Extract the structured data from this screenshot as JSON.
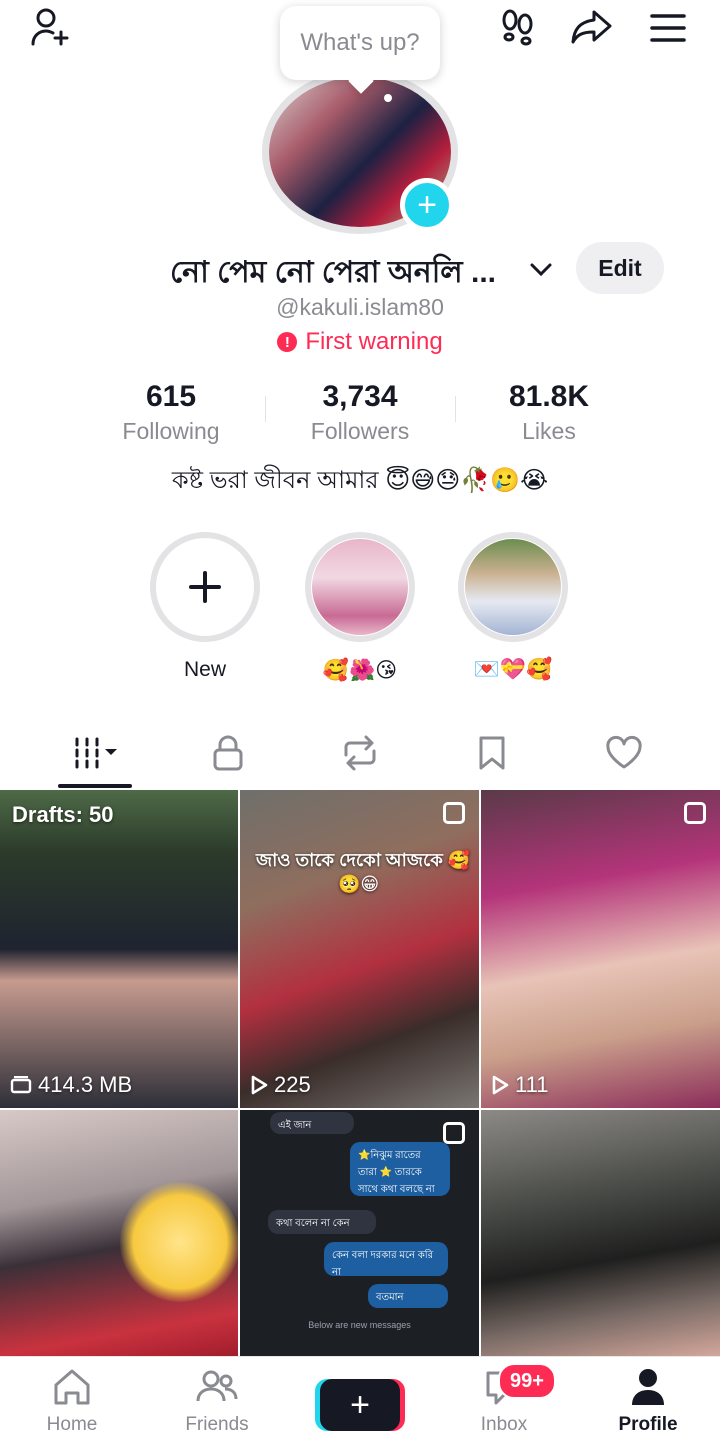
{
  "bubble": {
    "text": "What's up?"
  },
  "profile": {
    "name": "নো পেম নো পেরা অনলি ...",
    "handle": "@kakuli.islam80",
    "warning": "First warning",
    "edit_label": "Edit",
    "bio": "কষ্ট ভরা জীবন আমার 😇😅😓🥀🥲😭"
  },
  "stats": [
    {
      "value": "615",
      "label": "Following"
    },
    {
      "value": "3,734",
      "label": "Followers"
    },
    {
      "value": "81.8K",
      "label": "Likes"
    }
  ],
  "highlights": [
    {
      "label": "New"
    },
    {
      "label": "🥰🌺😘"
    },
    {
      "label": "💌💝🥰"
    }
  ],
  "grid": {
    "drafts": "Drafts: 50",
    "drafts_size": "414.3 MB",
    "video2_caption": "জাও তাকে দেকো আজকে 🥰",
    "video2_caption2": "🥺😁",
    "video2_views": "225",
    "video3_views": "111",
    "chat": {
      "m1": "এই জান",
      "m2": "⭐নিঝুম রাতের তারা ⭐ তারকে সাথে কথা বলছে না",
      "m3": "কথা বলেন না কেন",
      "m4": "কেন বলা দরকার মনে করি না",
      "m5": "বতমান",
      "m6": "Below are new messages"
    }
  },
  "nav": {
    "home": "Home",
    "friends": "Friends",
    "create": "+",
    "inbox": "Inbox",
    "inbox_badge": "99+",
    "profile": "Profile"
  },
  "colors": {
    "accent_cyan": "#20d5ec",
    "accent_red": "#fe2c55",
    "text_primary": "#161823",
    "text_secondary": "#8a8b91"
  }
}
